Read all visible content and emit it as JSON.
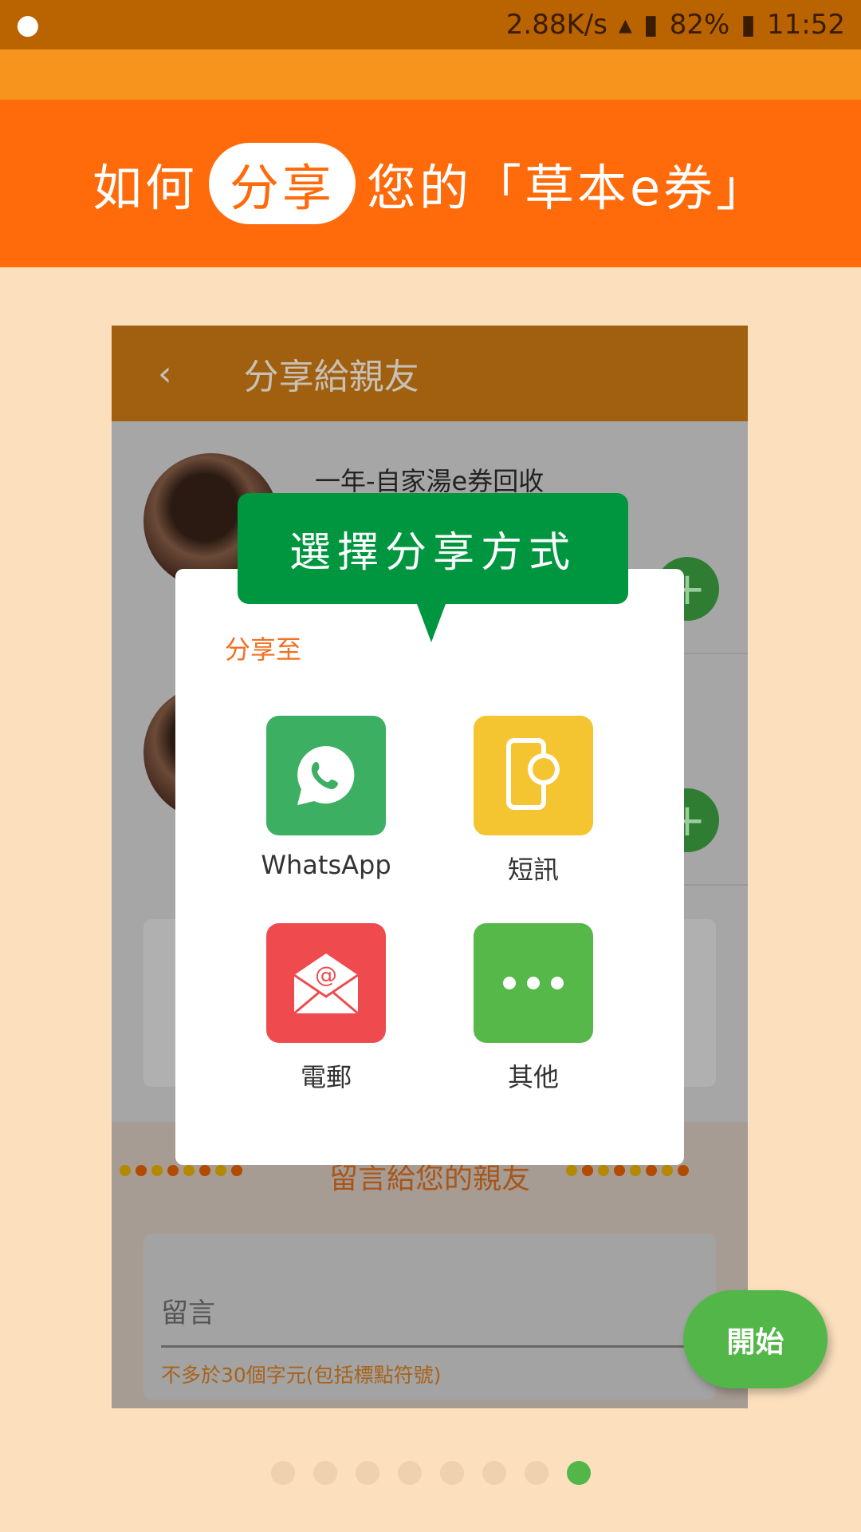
{
  "status_bar": {
    "speed": "2.88K/s",
    "battery": "82%",
    "time": "11:52"
  },
  "header": {
    "prefix": "如何",
    "highlight": "分享",
    "suffix": "您的「草本e券」"
  },
  "mockup": {
    "title": "分享給親友",
    "back_icon": "chevron-left-icon",
    "item_title": "一年-自家湯e券回收",
    "message_section_title": "留言給您的親友",
    "message_label": "留言",
    "message_hint": "不多於30個字元(包括標點符號)"
  },
  "tooltip": "選擇分享方式",
  "dialog": {
    "title": "分享至",
    "options": [
      {
        "label": "WhatsApp",
        "icon": "whatsapp-icon",
        "color": "#3daf63"
      },
      {
        "label": "短訊",
        "icon": "sms-icon",
        "color": "#f4c531"
      },
      {
        "label": "電郵",
        "icon": "email-icon",
        "color": "#ef4b4f"
      },
      {
        "label": "其他",
        "icon": "more-icon",
        "color": "#55b848"
      }
    ]
  },
  "fab": "開始",
  "pager": {
    "total": 8,
    "current": 8
  }
}
